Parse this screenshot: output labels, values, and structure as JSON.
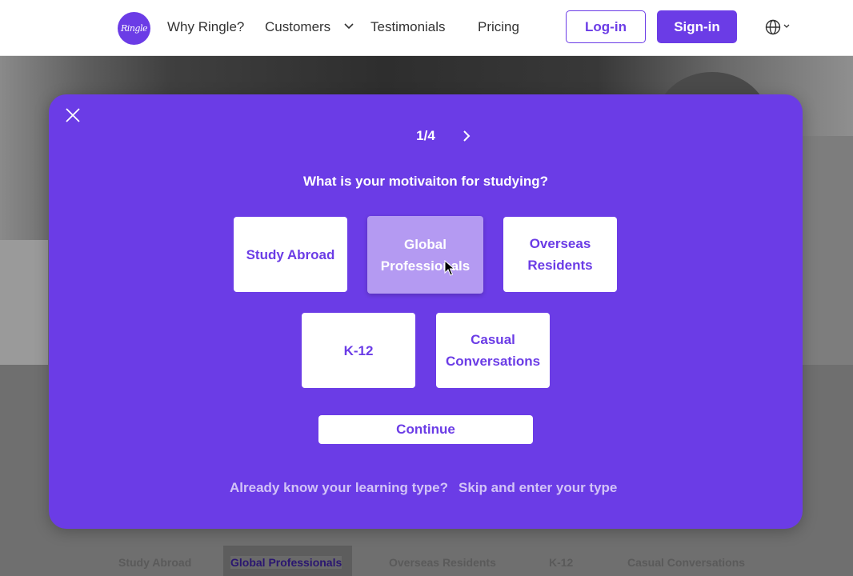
{
  "header": {
    "logo_text": "Ringle",
    "nav": {
      "why": "Why Ringle?",
      "customers": "Customers",
      "testimonials": "Testimonials",
      "pricing": "Pricing"
    },
    "login_label": "Log-in",
    "signin_label": "Sign-in"
  },
  "background_tabs": [
    "Study Abroad",
    "Global Professionals",
    "Overseas Residents",
    "K-12",
    "Casual Conversations"
  ],
  "modal": {
    "step": "1/4",
    "question": "What is your motivaiton for studying?",
    "options": [
      {
        "label": "Study Abroad",
        "selected": false
      },
      {
        "label": "Global Professionals",
        "selected": true
      },
      {
        "label": "Overseas Residents",
        "selected": false
      },
      {
        "label": "K-12",
        "selected": false
      },
      {
        "label": "Casual Conversations",
        "selected": false
      }
    ],
    "continue_label": "Continue",
    "footer_question": "Already know your learning type?",
    "footer_link": "Skip and enter your type"
  },
  "colors": {
    "brand": "#6b3ce6",
    "selected_option": "#b49af2",
    "footer_text": "#d2c3f7"
  }
}
